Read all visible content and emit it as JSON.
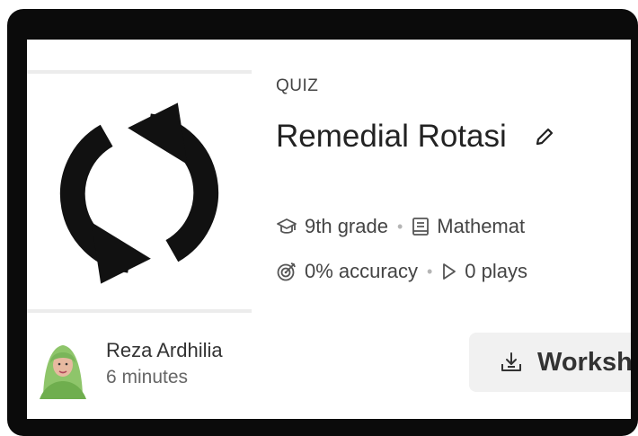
{
  "quiz": {
    "type_label": "QUIZ",
    "title": "Remedial Rotasi",
    "grade": "9th grade",
    "subject": "Mathemat",
    "accuracy": "0% accuracy",
    "plays": "0 plays"
  },
  "author": {
    "name": "Reza Ardhilia",
    "time": "6 minutes"
  },
  "actions": {
    "worksheet_label": "Worksh"
  },
  "icons": {
    "thumbnail": "rotate-arrows-icon",
    "edit": "pencil-icon",
    "grade": "graduation-cap-icon",
    "subject": "book-icon",
    "accuracy": "target-icon",
    "plays": "play-icon",
    "worksheet": "download-tray-icon"
  }
}
